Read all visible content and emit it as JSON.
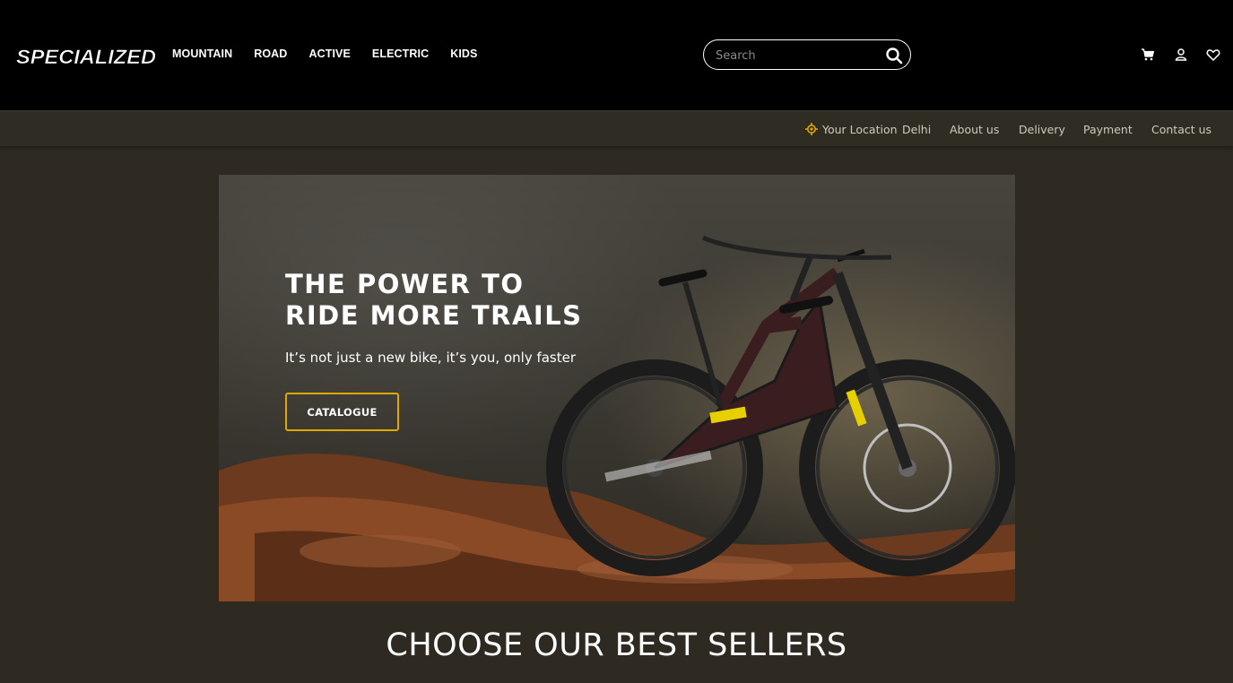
{
  "brand": {
    "logo_text": "SPECIALIZED"
  },
  "nav": {
    "items": [
      "MOUNTAIN",
      "ROAD",
      "ACTIVE",
      "ELECTRIC",
      "KIDS"
    ]
  },
  "search": {
    "placeholder": "Search",
    "value": ""
  },
  "header_icons": [
    "cart-icon",
    "user-icon",
    "heart-icon"
  ],
  "subbar": {
    "location_label": "Your Location",
    "location_value": "Delhi",
    "links": [
      "About us",
      "Delivery",
      "Payment",
      "Contact us"
    ]
  },
  "hero": {
    "title_line1": "THE POWER TO",
    "title_line2": "RIDE MORE TRAILS",
    "subtitle": "It’s not just a new bike, it’s you, only faster",
    "button_label": "CATALOGUE"
  },
  "section": {
    "title": "CHOOSE OUR BEST SELLERS"
  },
  "colors": {
    "header_bg": "#000000",
    "page_bg": "#2e2a21",
    "accent": "#e0a800"
  }
}
